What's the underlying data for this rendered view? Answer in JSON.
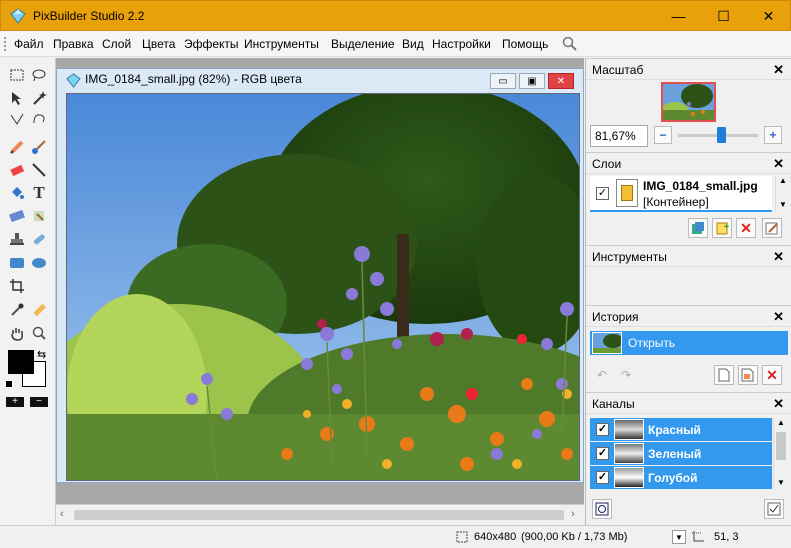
{
  "window": {
    "title": "PixBuilder Studio 2.2",
    "minimize": "—",
    "maximize": "☐",
    "close": "✕"
  },
  "menu": [
    "Файл",
    "Правка",
    "Слой",
    "Цвета",
    "Эффекты",
    "Инструменты",
    "Выделение",
    "Вид",
    "Настройки",
    "Помощь"
  ],
  "document": {
    "title": "IMG_0184_small.jpg (82%) - RGB цвета"
  },
  "panels": {
    "scale": {
      "title": "Масштаб",
      "zoom_value": "81,67%",
      "zoom_level": 0.55
    },
    "layers": {
      "title": "Слои",
      "layer_name": "IMG_0184_small.jpg",
      "layer_type": "[Контейнер]"
    },
    "tools": {
      "title": "Инструменты"
    },
    "history": {
      "title": "История",
      "item": "Открыть"
    },
    "channels": {
      "title": "Каналы",
      "items": [
        "Красный",
        "Зеленый",
        "Голубой"
      ]
    }
  },
  "status": {
    "dimensions": "640x480",
    "size": "(900,00 Kb / 1,73 Mb)",
    "cursor": "51, 3"
  },
  "colors": {
    "titlebar": "#e8a10b",
    "selection": "#3399ee"
  }
}
